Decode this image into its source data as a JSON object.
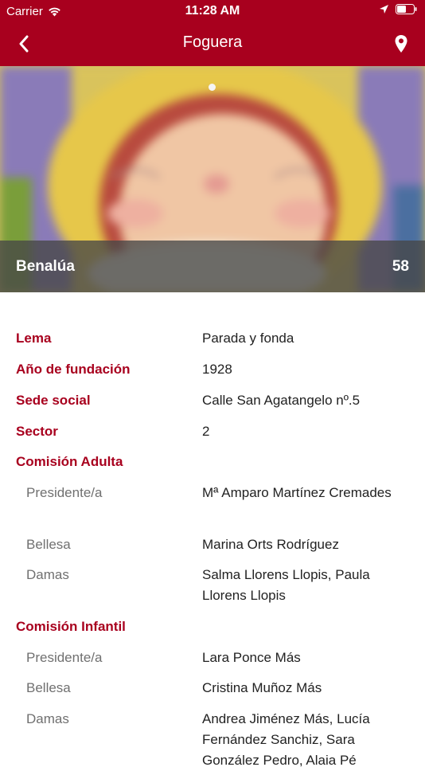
{
  "status_bar": {
    "carrier": "Carrier",
    "time": "11:28 AM"
  },
  "nav": {
    "title": "Foguera",
    "back_icon": "chevron-left-icon",
    "location_icon": "map-pin-icon"
  },
  "hero": {
    "name": "Benalúa",
    "number": "58",
    "page_indicator_count": 1,
    "page_indicator_active": 1
  },
  "colors": {
    "brand": "#a8001e",
    "label_muted": "#707070"
  },
  "details": [
    {
      "kind": "key",
      "label": "Lema",
      "value": "Parada y fonda"
    },
    {
      "kind": "key",
      "label": "Año de fundación",
      "value": "1928"
    },
    {
      "kind": "key",
      "label": "Sede social",
      "value": "Calle San Agatangelo nº.5"
    },
    {
      "kind": "key",
      "label": "Sector",
      "value": "2"
    },
    {
      "kind": "key",
      "label": "Comisión Adulta",
      "value": ""
    },
    {
      "kind": "sub",
      "label": "Presidente/a",
      "value": "Mª Amparo Martínez Cremades"
    },
    {
      "kind": "sub",
      "label": "Bellesa",
      "value": "Marina Orts Rodríguez"
    },
    {
      "kind": "sub",
      "label": "Damas",
      "value": "Salma Llorens Llopis, Paula Llorens Llopis"
    },
    {
      "kind": "key",
      "label": "Comisión Infantil",
      "value": ""
    },
    {
      "kind": "sub",
      "label": "Presidente/a",
      "value": "Lara Ponce Más"
    },
    {
      "kind": "sub",
      "label": "Bellesa",
      "value": "Cristina Muñoz Más"
    },
    {
      "kind": "sub",
      "label": "Damas",
      "value": "Andrea Jiménez Más, Lucía Fernández Sanchiz, Sara González Pedro, Alaia Pé"
    }
  ]
}
